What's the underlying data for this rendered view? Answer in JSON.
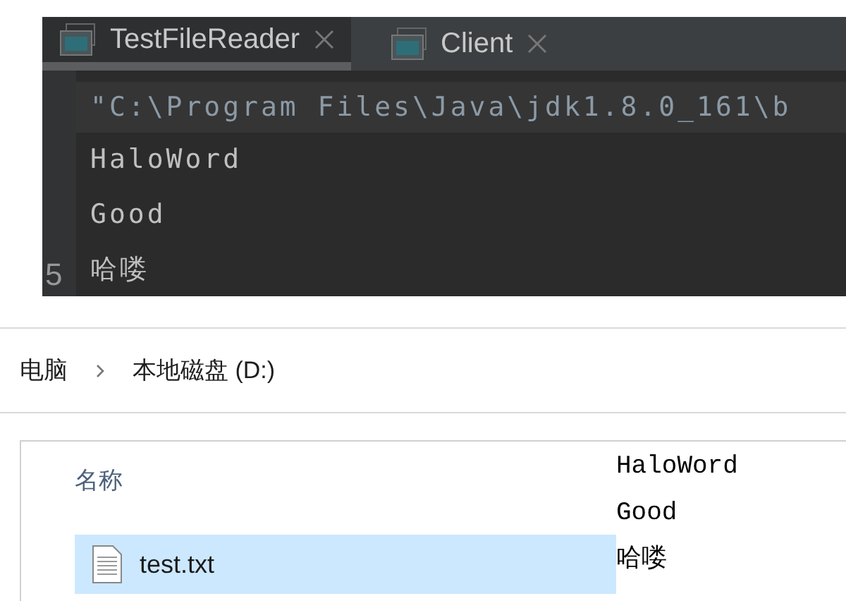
{
  "ide": {
    "tabs": [
      {
        "label": "TestFileReader",
        "selected": true
      },
      {
        "label": "Client",
        "selected": false
      }
    ],
    "gutter": [
      "5"
    ],
    "console": {
      "command": "\"C:\\Program Files\\Java\\jdk1.8.0_161\\b",
      "output": [
        "HaloWord",
        "Good",
        "哈喽"
      ]
    }
  },
  "explorer": {
    "breadcrumb": [
      "电脑",
      "本地磁盘 (D:)"
    ],
    "columns": [
      "名称"
    ],
    "files": [
      {
        "name": "test.txt",
        "selected": true
      }
    ]
  },
  "file_content": [
    "HaloWord",
    "Good",
    "哈喽"
  ]
}
